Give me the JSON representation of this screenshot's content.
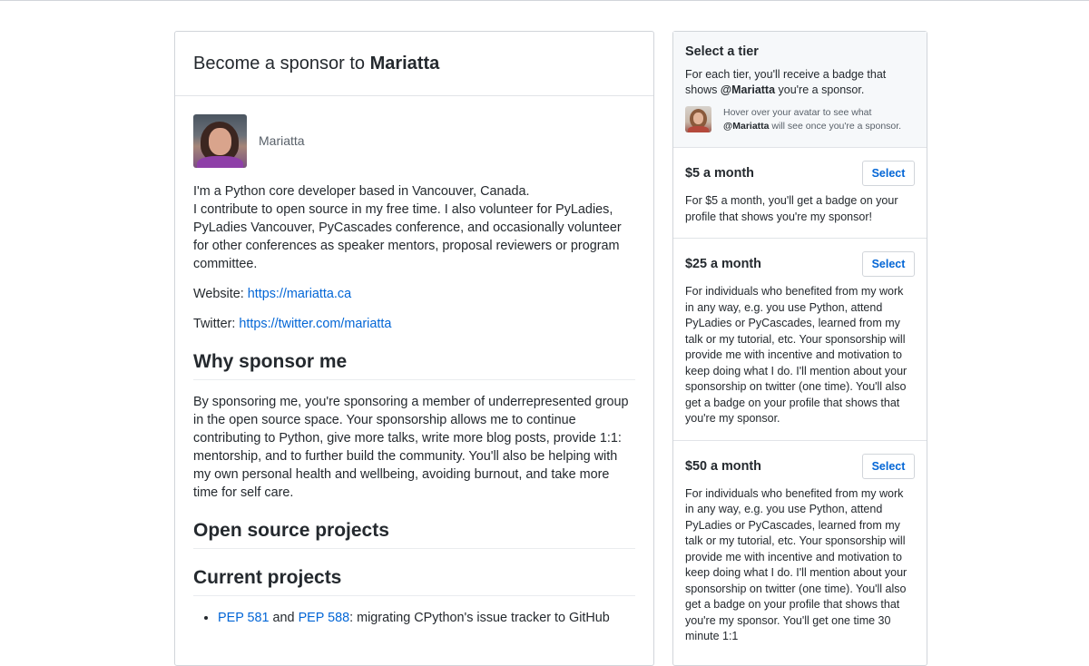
{
  "main": {
    "title_prefix": "Become a sponsor to",
    "title_name": "Mariatta",
    "profile_name": "Mariatta",
    "bio_lines": [
      "I'm a Python core developer based in Vancouver, Canada.",
      "I contribute to open source in my free time. I also volunteer for PyLadies, PyLadies Vancouver, PyCascades conference, and occasionally volunteer for other conferences as speaker mentors, proposal reviewers or program committee."
    ],
    "website_label": "Website:",
    "website_url": "https://mariatta.ca",
    "twitter_label": "Twitter:",
    "twitter_url": "https://twitter.com/mariatta",
    "why_heading": "Why sponsor me",
    "why_text": "By sponsoring me, you're sponsoring a member of underrepresented group in the open source space. Your sponsorship allows me to continue contributing to Python, give more talks, write more blog posts, provide 1:1: mentorship, and to further build the community. You'll also be helping with my own personal health and wellbeing, avoiding burnout, and take more time for self care.",
    "oss_heading": "Open source projects",
    "current_heading": "Current projects",
    "projects": [
      {
        "link1": "PEP 581",
        "mid": " and ",
        "link2": "PEP 588",
        "rest": ": migrating CPython's issue tracker to GitHub"
      }
    ]
  },
  "sidebar": {
    "title": "Select a tier",
    "desc_prefix": "For each tier, you'll receive a badge that shows",
    "desc_handle": "@Mariatta",
    "desc_suffix": " you're a sponsor.",
    "hover_prefix": "Hover over your avatar to see what",
    "hover_handle": "@Mariatta",
    "hover_suffix": " will see once you're a sponsor.",
    "tiers": [
      {
        "price": "$5 a month",
        "button": "Select",
        "desc": "For $5 a month, you'll get a badge on your profile that shows you're my sponsor!"
      },
      {
        "price": "$25 a month",
        "button": "Select",
        "desc": "For individuals who benefited from my work in any way, e.g. you use Python, attend PyLadies or PyCascades, learned from my talk or my tutorial, etc. Your sponsorship will provide me with incentive and motivation to keep doing what I do. I'll mention about your sponsorship on twitter (one time). You'll also get a badge on your profile that shows that you're my sponsor."
      },
      {
        "price": "$50 a month",
        "button": "Select",
        "desc": "For individuals who benefited from my work in any way, e.g. you use Python, attend PyLadies or PyCascades, learned from my talk or my tutorial, etc. Your sponsorship will provide me with incentive and motivation to keep doing what I do. I'll mention about your sponsorship on twitter (one time). You'll also get a badge on your profile that shows that you're my sponsor. You'll get one time 30 minute 1:1"
      }
    ]
  },
  "colors": {
    "link": "#0366d6",
    "border": "#d1d5da",
    "text": "#24292e",
    "muted": "#586069",
    "header_bg": "#f6f8fa"
  }
}
